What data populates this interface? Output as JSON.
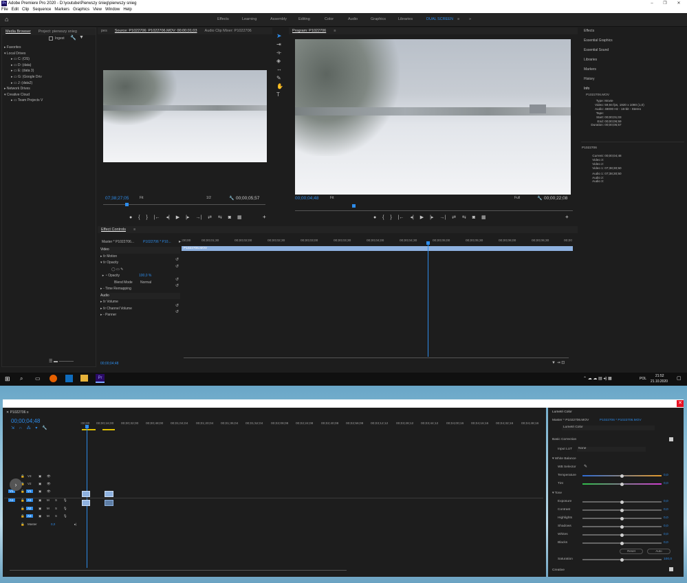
{
  "window": {
    "title": "Adobe Premiere Pro 2020 - D:\\youtube\\Pierwszy śnieg\\pierwszy snieg",
    "logo": "Pr"
  },
  "menu": [
    "File",
    "Edit",
    "Clip",
    "Sequence",
    "Markers",
    "Graphics",
    "View",
    "Window",
    "Help"
  ],
  "workspaces": [
    "Effects",
    "Learning",
    "Assembly",
    "Editing",
    "Color",
    "Audio",
    "Graphics",
    "Libraries",
    "DUAL SCREEN"
  ],
  "workspace_active": "DUAL SCREEN",
  "project_panel": {
    "tabs": [
      "Media Browser",
      "Project: pierwszy snieg"
    ],
    "ingest": "Ingest",
    "tree": [
      "Favorites",
      "Local Drives",
      "C: (OS)",
      "D: (data)",
      "E: (data 3)",
      "G: (Google Driv",
      "J: (data2)",
      "Network Drives",
      "Creative Cloud",
      "Team Projects V"
    ]
  },
  "source": {
    "tabs": [
      "pes",
      "Source: P1022706: P1022706.MOV: 00;00;01;03",
      "Audio Clip Mixer: P1022706"
    ],
    "timecode": "07;38;27;05",
    "fit": "Fit",
    "ratio": "1/2",
    "duration": "00;00;05;57"
  },
  "program": {
    "tab": "Program: P1022706",
    "timecode": "00;00;04;48",
    "fit": "Fit",
    "quality": "Full",
    "duration": "00;00;22;08"
  },
  "right_panel": {
    "items": [
      "Effects",
      "Essential Graphics",
      "Essential Sound",
      "Libraries",
      "Markers",
      "History",
      "Info"
    ],
    "info_file": "P1022706.MOV",
    "info_rows": [
      [
        "Type:",
        "Movie"
      ],
      [
        "Video:",
        "59,94 fps, 1920 x 1080 (1,0)"
      ],
      [
        "Audio:",
        "48000 Hz - 16-bit - Stereo"
      ],
      [
        "Tape:",
        ""
      ],
      [
        "Start:",
        "00;00;01;03"
      ],
      [
        "End:",
        "00;00;06;59"
      ],
      [
        "Duration:",
        "00;00;05;57"
      ]
    ],
    "seq_name": "P1022706",
    "seq_rows": [
      [
        "Current:",
        "00;00;04;48"
      ],
      [
        "Video 3:",
        ""
      ],
      [
        "Video 2:",
        ""
      ],
      [
        "Video 1:",
        "07;38;30;50"
      ],
      [
        "Audio 1:",
        "07;38;30;50"
      ],
      [
        "Audio 2:",
        ""
      ],
      [
        "Audio 3:",
        ""
      ]
    ]
  },
  "effect_controls": {
    "tabs": [
      "Effect Controls",
      "≡"
    ],
    "master": "Master * P1022706...",
    "seq": "P1022706 * P10...",
    "clip": "P1022706.MOV",
    "ruler": [
      ";00;00",
      "00;00;01;30",
      "00;00;02;00",
      "00;00;02;30",
      "00;00;03;00",
      "00;00;03;30",
      "00;00;04;00",
      "00;00;04;30",
      "00;00;05;00",
      "00;00;05;30",
      "00;00;06;00",
      "00;00;06;30",
      "00;00"
    ],
    "rows": [
      "Video",
      "Motion",
      "Opacity",
      "",
      "Opacity",
      "Blend Mode",
      "Time Remapping",
      "Audio",
      "Volume",
      "Channel Volume",
      "Panner"
    ],
    "opacity_value": "100,0 %",
    "blend_value": "Normal",
    "timecode": "00;00;04;48"
  },
  "taskbar": {
    "time": "21:52",
    "date": "21.10.2020",
    "lang": "POL"
  },
  "timeline": {
    "title": "P1022706",
    "timecode": "00;00;04;48",
    "ruler": [
      ":00;00",
      "00;00;16;00",
      "00;00;32;00",
      "00;00;48;00",
      "00;01;04;04",
      "00;01;20;04",
      "00;01;36;04",
      "00;01;52;04",
      "00;02;08;08",
      "00;02;24;08",
      "00;02;40;08",
      "00;02;56;08",
      "00;03;12;12",
      "00;03;28;12",
      "00;03;44;12",
      "00;04;00;16",
      "00;04;16;16",
      "00;04;32;16",
      "00;04;48;16"
    ],
    "tracks_video": [
      "V3",
      "V2",
      "V1"
    ],
    "tracks_audio": [
      "A1",
      "A2",
      "A3"
    ],
    "master": "Master",
    "master_val": "0,0"
  },
  "lumetri": {
    "title": "Lumetri Color",
    "master": "Master * P1022706.MOV",
    "seq": "P1022706 * P1022706.MOV",
    "effect": "Lumetri Color",
    "basic": "Basic Correction",
    "input_lut": "Input LUT",
    "lut_value": "None",
    "white_balance": "White Balance",
    "wb_selector": "WB Selector",
    "temperature": "Temperature",
    "temperature_val": "0,0",
    "tint": "Tint",
    "tint_val": "0,0",
    "tone": "Tone",
    "tone_rows": [
      [
        "Exposure",
        "0,0"
      ],
      [
        "Contrast",
        "0,0"
      ],
      [
        "Highlights",
        "0,0"
      ],
      [
        "Shadows",
        "0,0"
      ],
      [
        "Whites",
        "0,0"
      ],
      [
        "Blacks",
        "0,0"
      ]
    ],
    "reset": "Reset",
    "auto": "Auto",
    "saturation": "Saturation",
    "saturation_val": "100,0",
    "creative": "Creative"
  },
  "colors": {
    "accent": "#2d8ceb",
    "panel": "#1d1d1d",
    "clip": "#8fb2e0"
  }
}
